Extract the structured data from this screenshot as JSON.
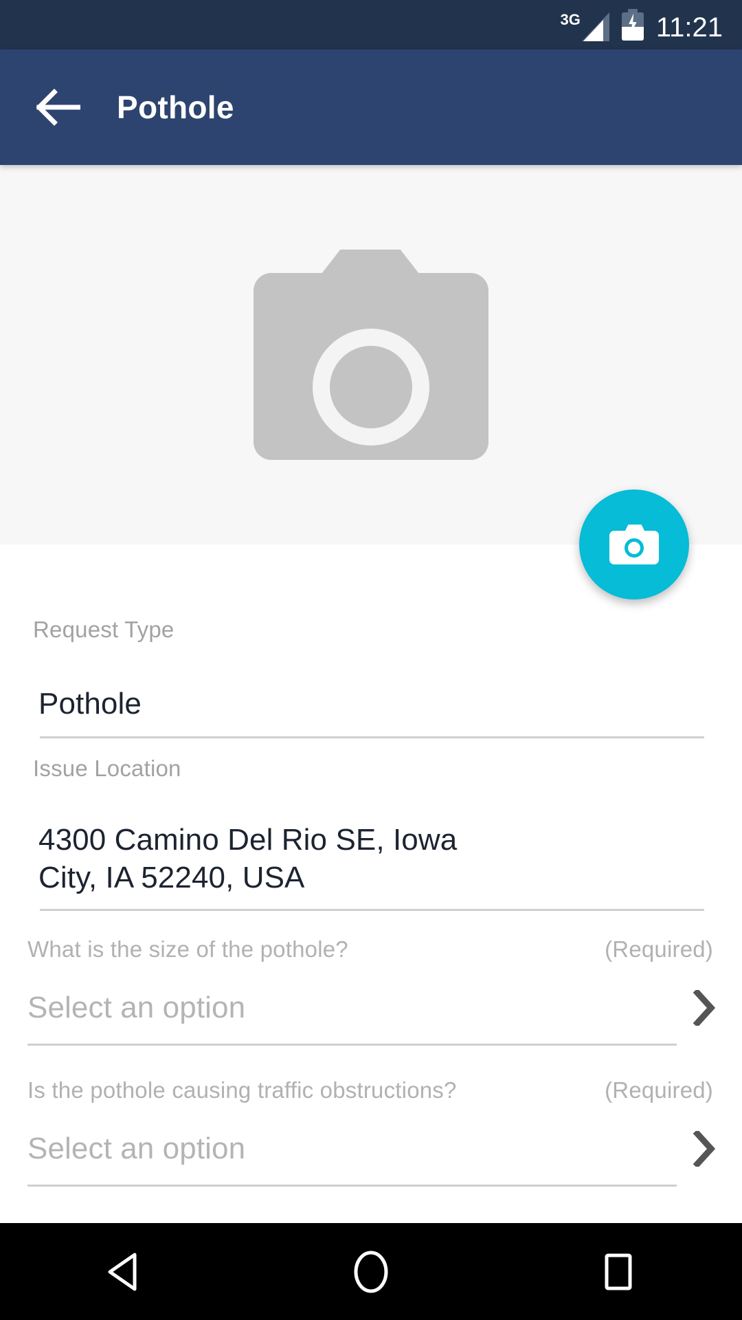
{
  "status_bar": {
    "network_type": "3G",
    "time": "11:21",
    "signal_icon": "signal-bars-icon",
    "battery_icon": "battery-charging-icon",
    "background_color": "#22334d"
  },
  "app_bar": {
    "title": "Pothole",
    "back_icon": "arrow-left-icon",
    "background_color": "#2e4470"
  },
  "photo": {
    "placeholder_icon": "camera-placeholder-icon",
    "background_color": "#f7f7f7",
    "capture_button": {
      "icon": "camera-icon",
      "color": "#06bcd6"
    }
  },
  "form": {
    "fields": [
      {
        "label": "Request Type",
        "value": "Pothole"
      },
      {
        "label": "Issue Location",
        "value": "4300 Camino Del Rio SE, Iowa City, IA 52240, USA"
      }
    ],
    "questions": [
      {
        "text": "What is the size of the pothole?",
        "required_text": "(Required)",
        "placeholder": "Select an option",
        "chevron_icon": "chevron-right-icon"
      },
      {
        "text": "Is the pothole causing traffic obstructions?",
        "required_text": "(Required)",
        "placeholder": "Select an option",
        "chevron_icon": "chevron-right-icon"
      }
    ]
  },
  "nav_bar": {
    "back_icon": "triangle-back-icon",
    "home_icon": "circle-home-icon",
    "recents_icon": "square-recents-icon",
    "background_color": "#000000"
  }
}
